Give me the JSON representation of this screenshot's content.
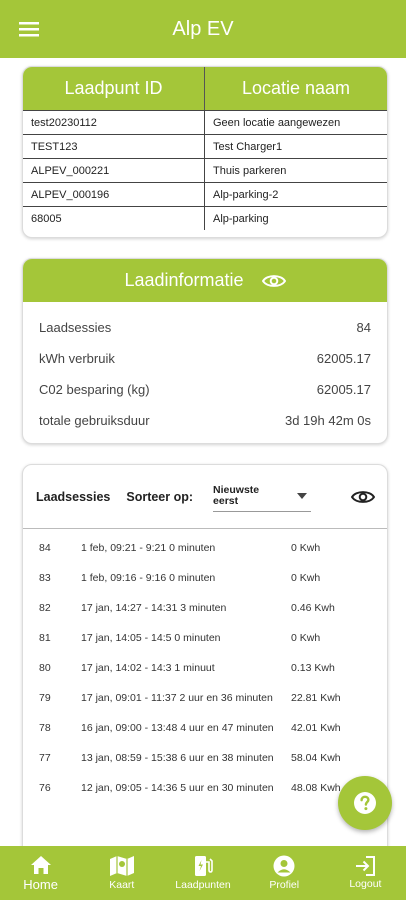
{
  "app": {
    "title": "Alp EV"
  },
  "chargepoints": {
    "headers": {
      "id": "Laadpunt ID",
      "location": "Locatie naam"
    },
    "rows": [
      {
        "id": "test20230112",
        "location": "Geen locatie aangewezen"
      },
      {
        "id": "TEST123",
        "location": "Test Charger1"
      },
      {
        "id": "ALPEV_000221",
        "location": "Thuis parkeren"
      },
      {
        "id": "ALPEV_000196",
        "location": "Alp-parking-2"
      },
      {
        "id": "68005",
        "location": "Alp-parking"
      }
    ]
  },
  "info": {
    "title": "Laadinformatie",
    "rows": [
      {
        "label": "Laadsessies",
        "value": "84"
      },
      {
        "label": "kWh verbruik",
        "value": "62005.17"
      },
      {
        "label": "C02 besparing (kg)",
        "value": "62005.17"
      },
      {
        "label": "totale gebruiksduur",
        "value": "3d 19h 42m 0s"
      }
    ]
  },
  "sessions": {
    "title": "Laadsessies",
    "sort_label": "Sorteer op:",
    "sort_value": "Nieuwste eerst",
    "rows": [
      {
        "n": "84",
        "desc": "1 feb, 09:21 - 9:21 0 minuten",
        "kwh": "0 Kwh"
      },
      {
        "n": "83",
        "desc": "1 feb, 09:16 - 9:16 0 minuten",
        "kwh": "0 Kwh"
      },
      {
        "n": "82",
        "desc": "17 jan, 14:27 - 14:31 3 minuten",
        "kwh": "0.46 Kwh"
      },
      {
        "n": "81",
        "desc": "17 jan, 14:05 - 14:5 0 minuten",
        "kwh": "0 Kwh"
      },
      {
        "n": "80",
        "desc": "17 jan, 14:02 - 14:3 1 minuut",
        "kwh": "0.13 Kwh"
      },
      {
        "n": "79",
        "desc": "17 jan, 09:01 - 11:37 2 uur en 36 minuten",
        "kwh": "22.81 Kwh"
      },
      {
        "n": "78",
        "desc": "16 jan, 09:00 - 13:48 4 uur en 47 minuten",
        "kwh": "42.01 Kwh"
      },
      {
        "n": "77",
        "desc": "13 jan, 08:59 - 15:38 6 uur en 38 minuten",
        "kwh": "58.04 Kwh"
      },
      {
        "n": "76",
        "desc": "12 jan, 09:05 - 14:36 5 uur en 30 minuten",
        "kwh": "48.08 Kwh"
      }
    ]
  },
  "nav": [
    {
      "label": "Home",
      "icon": "home-icon"
    },
    {
      "label": "Kaart",
      "icon": "map-icon"
    },
    {
      "label": "Laadpunten",
      "icon": "charger-icon"
    },
    {
      "label": "Profiel",
      "icon": "profile-icon"
    },
    {
      "label": "Logout",
      "icon": "logout-icon"
    }
  ],
  "colors": {
    "accent": "#a4c639"
  }
}
